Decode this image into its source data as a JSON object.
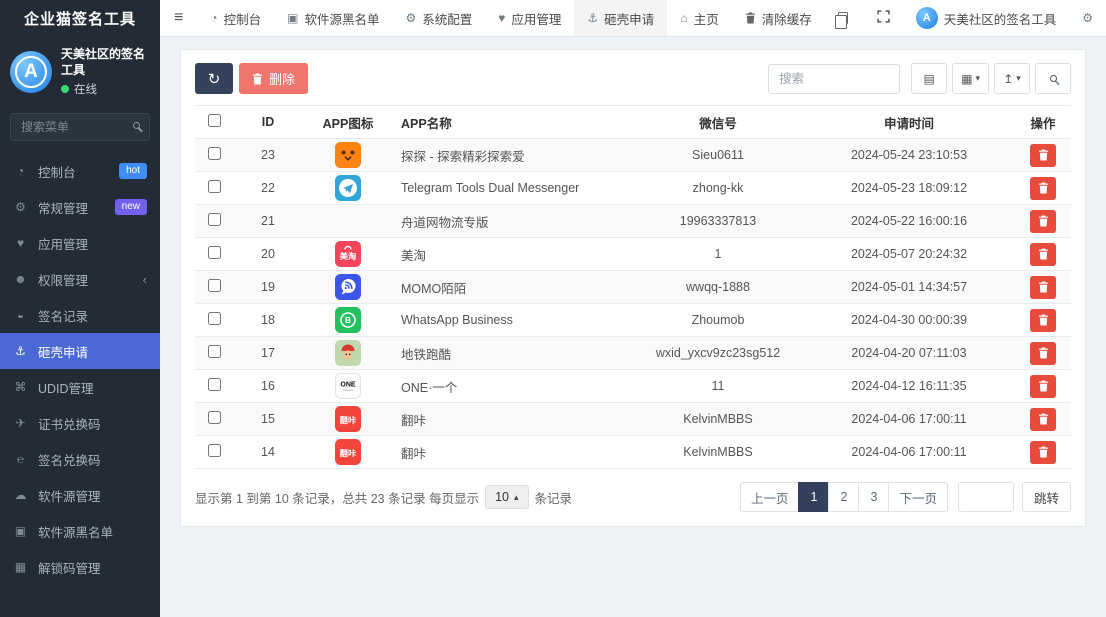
{
  "brand": {
    "title": "企业猫签名工具"
  },
  "topbar": {
    "menu_icon": "hamburger-icon",
    "items": [
      {
        "key": "dashboard",
        "label": "控制台",
        "icon": "dashboard-icon",
        "active": false
      },
      {
        "key": "source-blacklist",
        "label": "软件源黑名单",
        "icon": "address-book-icon",
        "active": false
      },
      {
        "key": "system-config",
        "label": "系统配置",
        "icon": "gear-icon",
        "active": false
      },
      {
        "key": "app-management",
        "label": "应用管理",
        "icon": "heart-icon",
        "active": false
      },
      {
        "key": "dump-request",
        "label": "砸壳申请",
        "icon": "anchor-icon",
        "active": true
      }
    ],
    "right": {
      "home": {
        "label": "主页",
        "icon": "home-icon"
      },
      "clear_cache": {
        "label": "清除缓存",
        "icon": "trash-icon"
      },
      "copy_icon": "copy-icon",
      "fullscreen_icon": "fullscreen-icon",
      "user": {
        "name": "天美社区的签名工具",
        "avatar_letter": "A"
      },
      "settings_icon": "cogs-icon"
    }
  },
  "sidebar": {
    "user": {
      "name": "天美社区的签名工具",
      "status": "在线",
      "status_color": "#3adb76",
      "avatar_letter": "A"
    },
    "search_placeholder": "搜索菜单",
    "items": [
      {
        "key": "dashboard",
        "label": "控制台",
        "icon": "dashboard-icon",
        "badge": "hot",
        "badge_color": "#3e8ef7"
      },
      {
        "key": "general",
        "label": "常规管理",
        "icon": "cogs-icon",
        "badge": "new",
        "badge_color": "#7460ee"
      },
      {
        "key": "apps",
        "label": "应用管理",
        "icon": "heart-icon"
      },
      {
        "key": "permissions",
        "label": "权限管理",
        "icon": "users-icon",
        "chevron": true
      },
      {
        "key": "sign-records",
        "label": "签名记录",
        "icon": "arrow-circle-down-icon"
      },
      {
        "key": "dump-request",
        "label": "砸壳申请",
        "icon": "anchor-icon",
        "active": true
      },
      {
        "key": "udid",
        "label": "UDID管理",
        "icon": "apple-icon"
      },
      {
        "key": "cert-codes",
        "label": "证书兑换码",
        "icon": "paper-plane-icon"
      },
      {
        "key": "sign-codes",
        "label": "签名兑换码",
        "icon": "edge-icon"
      },
      {
        "key": "sources",
        "label": "软件源管理",
        "icon": "cloud-icon"
      },
      {
        "key": "source-blacklist",
        "label": "软件源黑名单",
        "icon": "address-book-icon"
      },
      {
        "key": "unlock-codes",
        "label": "解锁码管理",
        "icon": "keyboard-icon"
      }
    ]
  },
  "toolbar": {
    "refresh_icon": "refresh-icon",
    "delete_label": "删除",
    "search_placeholder": "搜索",
    "buttons": [
      {
        "key": "detail-view",
        "icon": "detail-view-icon",
        "caret": false
      },
      {
        "key": "columns",
        "icon": "columns-icon",
        "caret": true
      },
      {
        "key": "export",
        "icon": "export-icon",
        "caret": true
      },
      {
        "key": "search",
        "icon": "search-icon",
        "caret": false
      }
    ]
  },
  "table": {
    "headers": [
      "ID",
      "APP图标",
      "APP名称",
      "微信号",
      "申请时间",
      "操作"
    ],
    "rows": [
      {
        "id": "23",
        "icon": "tantan",
        "name": "探探 - 探索精彩探索爱",
        "wechat": "Sieu0611",
        "time": "2024-05-24 23:10:53"
      },
      {
        "id": "22",
        "icon": "telegram",
        "name": "Telegram Tools Dual Messenger",
        "wechat": "zhong-kk",
        "time": "2024-05-23 18:09:12"
      },
      {
        "id": "21",
        "icon": "none",
        "name": "舟道网物流专版",
        "wechat": "19963337813",
        "time": "2024-05-22 16:00:16"
      },
      {
        "id": "20",
        "icon": "meitao",
        "name": "美淘",
        "wechat": "1",
        "time": "2024-05-07 20:24:32"
      },
      {
        "id": "19",
        "icon": "momo",
        "name": "MOMO陌陌",
        "wechat": "wwqq-1888",
        "time": "2024-05-01 14:34:57"
      },
      {
        "id": "18",
        "icon": "whatsapp",
        "name": "WhatsApp Business",
        "wechat": "Zhoumob",
        "time": "2024-04-30 00:00:39"
      },
      {
        "id": "17",
        "icon": "subway",
        "name": "地铁跑酷",
        "wechat": "wxid_yxcv9zc23sg512",
        "time": "2024-04-20 07:11:03"
      },
      {
        "id": "16",
        "icon": "one",
        "name": "ONE·一个",
        "wechat": "11",
        "time": "2024-04-12 16:11:35"
      },
      {
        "id": "15",
        "icon": "fanka",
        "name": "翻咔",
        "wechat": "KelvinMBBS",
        "time": "2024-04-06 17:00:11"
      },
      {
        "id": "14",
        "icon": "fanka",
        "name": "翻咔",
        "wechat": "KelvinMBBS",
        "time": "2024-04-06 17:00:11"
      }
    ]
  },
  "footer": {
    "summary_before": "显示第 1 到第 10 条记录，总共 23 条记录 每页显示",
    "page_size": "10",
    "summary_after": "条记录",
    "pagination": {
      "prev": "上一页",
      "pages": [
        "1",
        "2",
        "3"
      ],
      "active_page": "1",
      "next": "下一页",
      "jump_label": "跳转"
    }
  },
  "colors": {
    "accent": "#4b69d4",
    "danger": "#e74b3c",
    "navy": "#35425b",
    "salmon": "#f0756c",
    "hot_badge": "#3e8ef7",
    "new_badge": "#7460ee",
    "online": "#3adb76"
  }
}
